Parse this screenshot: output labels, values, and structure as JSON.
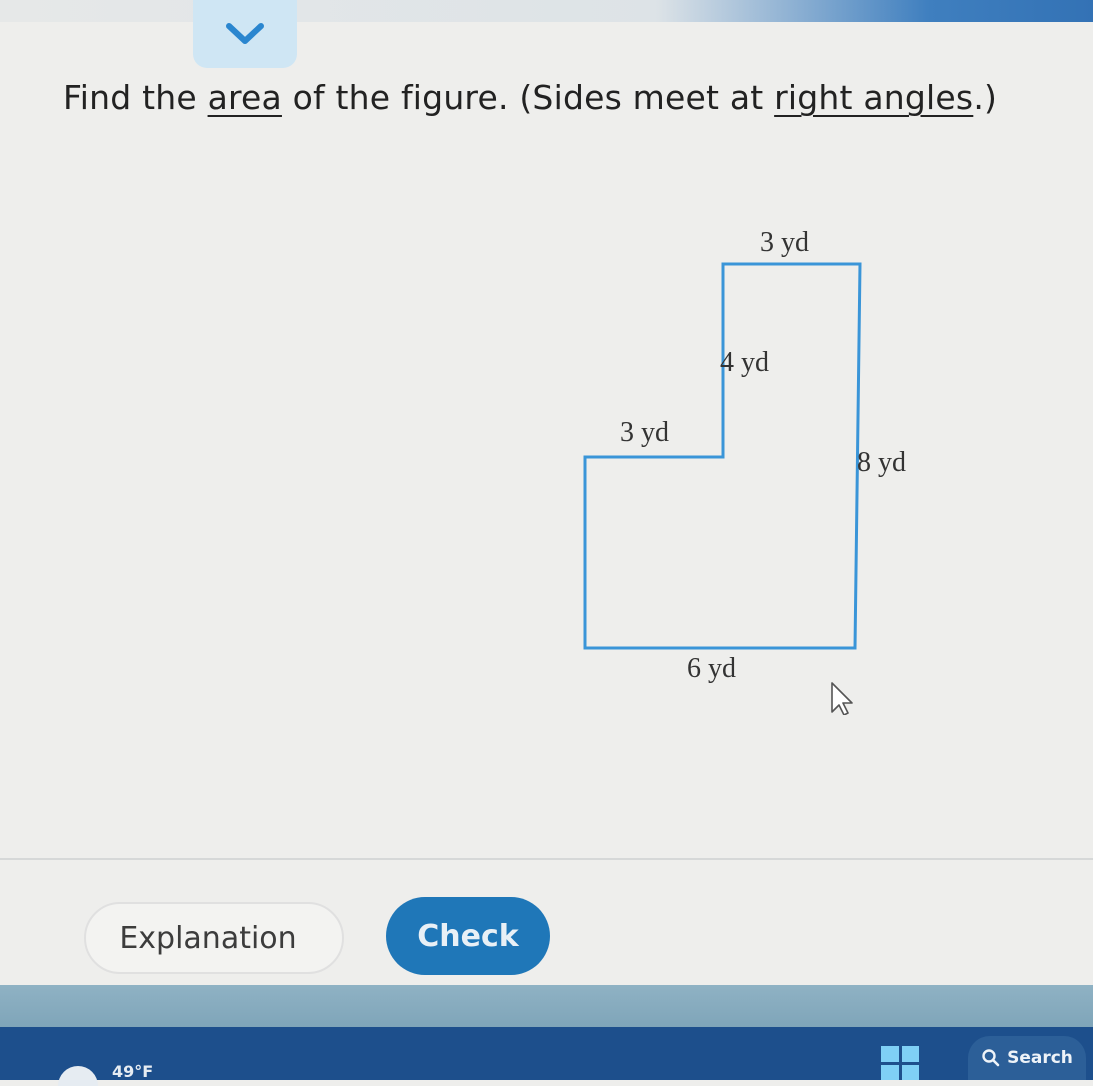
{
  "question": {
    "part1": "Find the ",
    "link_area": "area",
    "part2": " of the figure. (Sides meet at ",
    "link_right_angles": "right angles",
    "part3": ".)"
  },
  "figure": {
    "label_top": "3 yd",
    "label_upper_left": "4 yd",
    "label_step": "3 yd",
    "label_right": "8 yd",
    "label_bottom": "6 yd",
    "outline_color": "#3a95d8"
  },
  "buttons": {
    "explanation": "Explanation",
    "check": "Check"
  },
  "taskbar": {
    "temperature": "49°F",
    "search": "Search"
  },
  "colors": {
    "accent": "#1f77b8",
    "taskbar": "#1d4f8c"
  },
  "icons": {
    "collapse": "chevron-down-icon",
    "cursor": "mouse-cursor-icon",
    "weather": "weather-icon",
    "start": "windows-start-icon",
    "search": "search-icon"
  }
}
